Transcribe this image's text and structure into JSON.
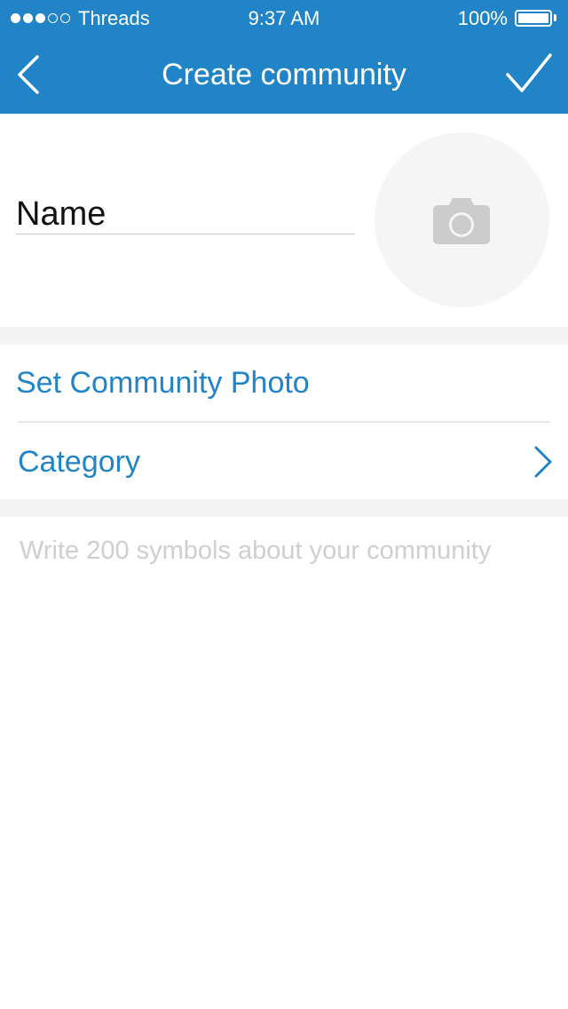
{
  "status_bar": {
    "signal": {
      "filled": 3,
      "total": 5
    },
    "carrier": "Threads",
    "time": "9:37 AM",
    "battery_percent": "100%",
    "battery_level": 1.0
  },
  "nav": {
    "title": "Create community",
    "back_icon": "chevron-left-icon",
    "done_icon": "checkmark-icon"
  },
  "form": {
    "name_placeholder": "Name",
    "name_value": "",
    "photo_icon": "camera-icon",
    "set_photo_label": "Set Community Photo",
    "category_label": "Category",
    "description_placeholder": "Write 200 symbols about your community",
    "description_value": ""
  },
  "colors": {
    "accent": "#2184c6",
    "background": "#ffffff",
    "section_gap": "#f4f4f4",
    "placeholder": "#cfcfcf",
    "photo_circle": "#f5f5f5",
    "camera_icon": "#cccccc"
  }
}
